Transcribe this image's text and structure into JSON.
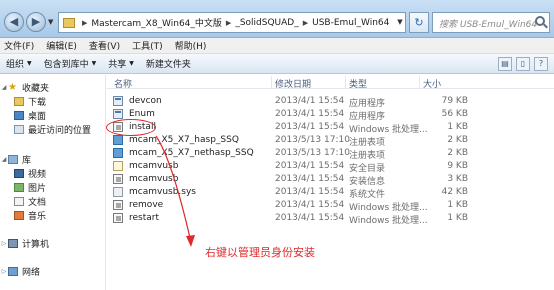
{
  "address": {
    "segments": [
      "Mastercam_X8_Win64_中文版",
      "_SolidSQUAD_",
      "USB-Emul_Win64"
    ],
    "search_placeholder": "搜索 USB-Emul_Win64"
  },
  "menu": [
    "文件(F)",
    "编辑(E)",
    "查看(V)",
    "工具(T)",
    "帮助(H)"
  ],
  "toolbar": {
    "organize": "组织",
    "include_in_library": "包含到库中",
    "share": "共享",
    "new_folder": "新建文件夹"
  },
  "nav": {
    "favorites": "收藏夹",
    "downloads": "下载",
    "desktop": "桌面",
    "recent": "最近访问的位置",
    "libraries": "库",
    "videos": "视频",
    "pictures": "图片",
    "documents": "文档",
    "music": "音乐",
    "computer": "计算机",
    "network": "网络"
  },
  "columns": {
    "name": "名称",
    "date": "修改日期",
    "type": "类型",
    "size": "大小"
  },
  "files": [
    {
      "name": "devcon",
      "date": "2013/4/1 15:54",
      "type": "应用程序",
      "size": "79 KB",
      "icon": "exe-icon"
    },
    {
      "name": "Enum",
      "date": "2013/4/1 15:54",
      "type": "应用程序",
      "size": "56 KB",
      "icon": "exe-icon"
    },
    {
      "name": "install",
      "date": "2013/4/1 15:54",
      "type": "Windows 批处理...",
      "size": "1 KB",
      "icon": "batch-icon"
    },
    {
      "name": "mcam_X5_X7_hasp_SSQ",
      "date": "2013/5/13 17:10",
      "type": "注册表项",
      "size": "2 KB",
      "icon": "registry-icon"
    },
    {
      "name": "mcam_X5_X7_nethasp_SSQ",
      "date": "2013/5/13 17:10",
      "type": "注册表项",
      "size": "2 KB",
      "icon": "registry-icon"
    },
    {
      "name": "mcamvusb",
      "date": "2013/4/1 15:54",
      "type": "安全目录",
      "size": "9 KB",
      "icon": "catalog-icon"
    },
    {
      "name": "mcamvusb",
      "date": "2013/4/1 15:54",
      "type": "安装信息",
      "size": "3 KB",
      "icon": "setup-info-icon"
    },
    {
      "name": "mcamvusb.sys",
      "date": "2013/4/1 15:54",
      "type": "系统文件",
      "size": "42 KB",
      "icon": "system-file-icon"
    },
    {
      "name": "remove",
      "date": "2013/4/1 15:54",
      "type": "Windows 批处理...",
      "size": "1 KB",
      "icon": "batch-icon"
    },
    {
      "name": "restart",
      "date": "2013/4/1 15:54",
      "type": "Windows 批处理...",
      "size": "1 KB",
      "icon": "batch-icon"
    }
  ],
  "annotation": {
    "text": "右键以管理员身份安装",
    "color": "#e02a2a"
  }
}
